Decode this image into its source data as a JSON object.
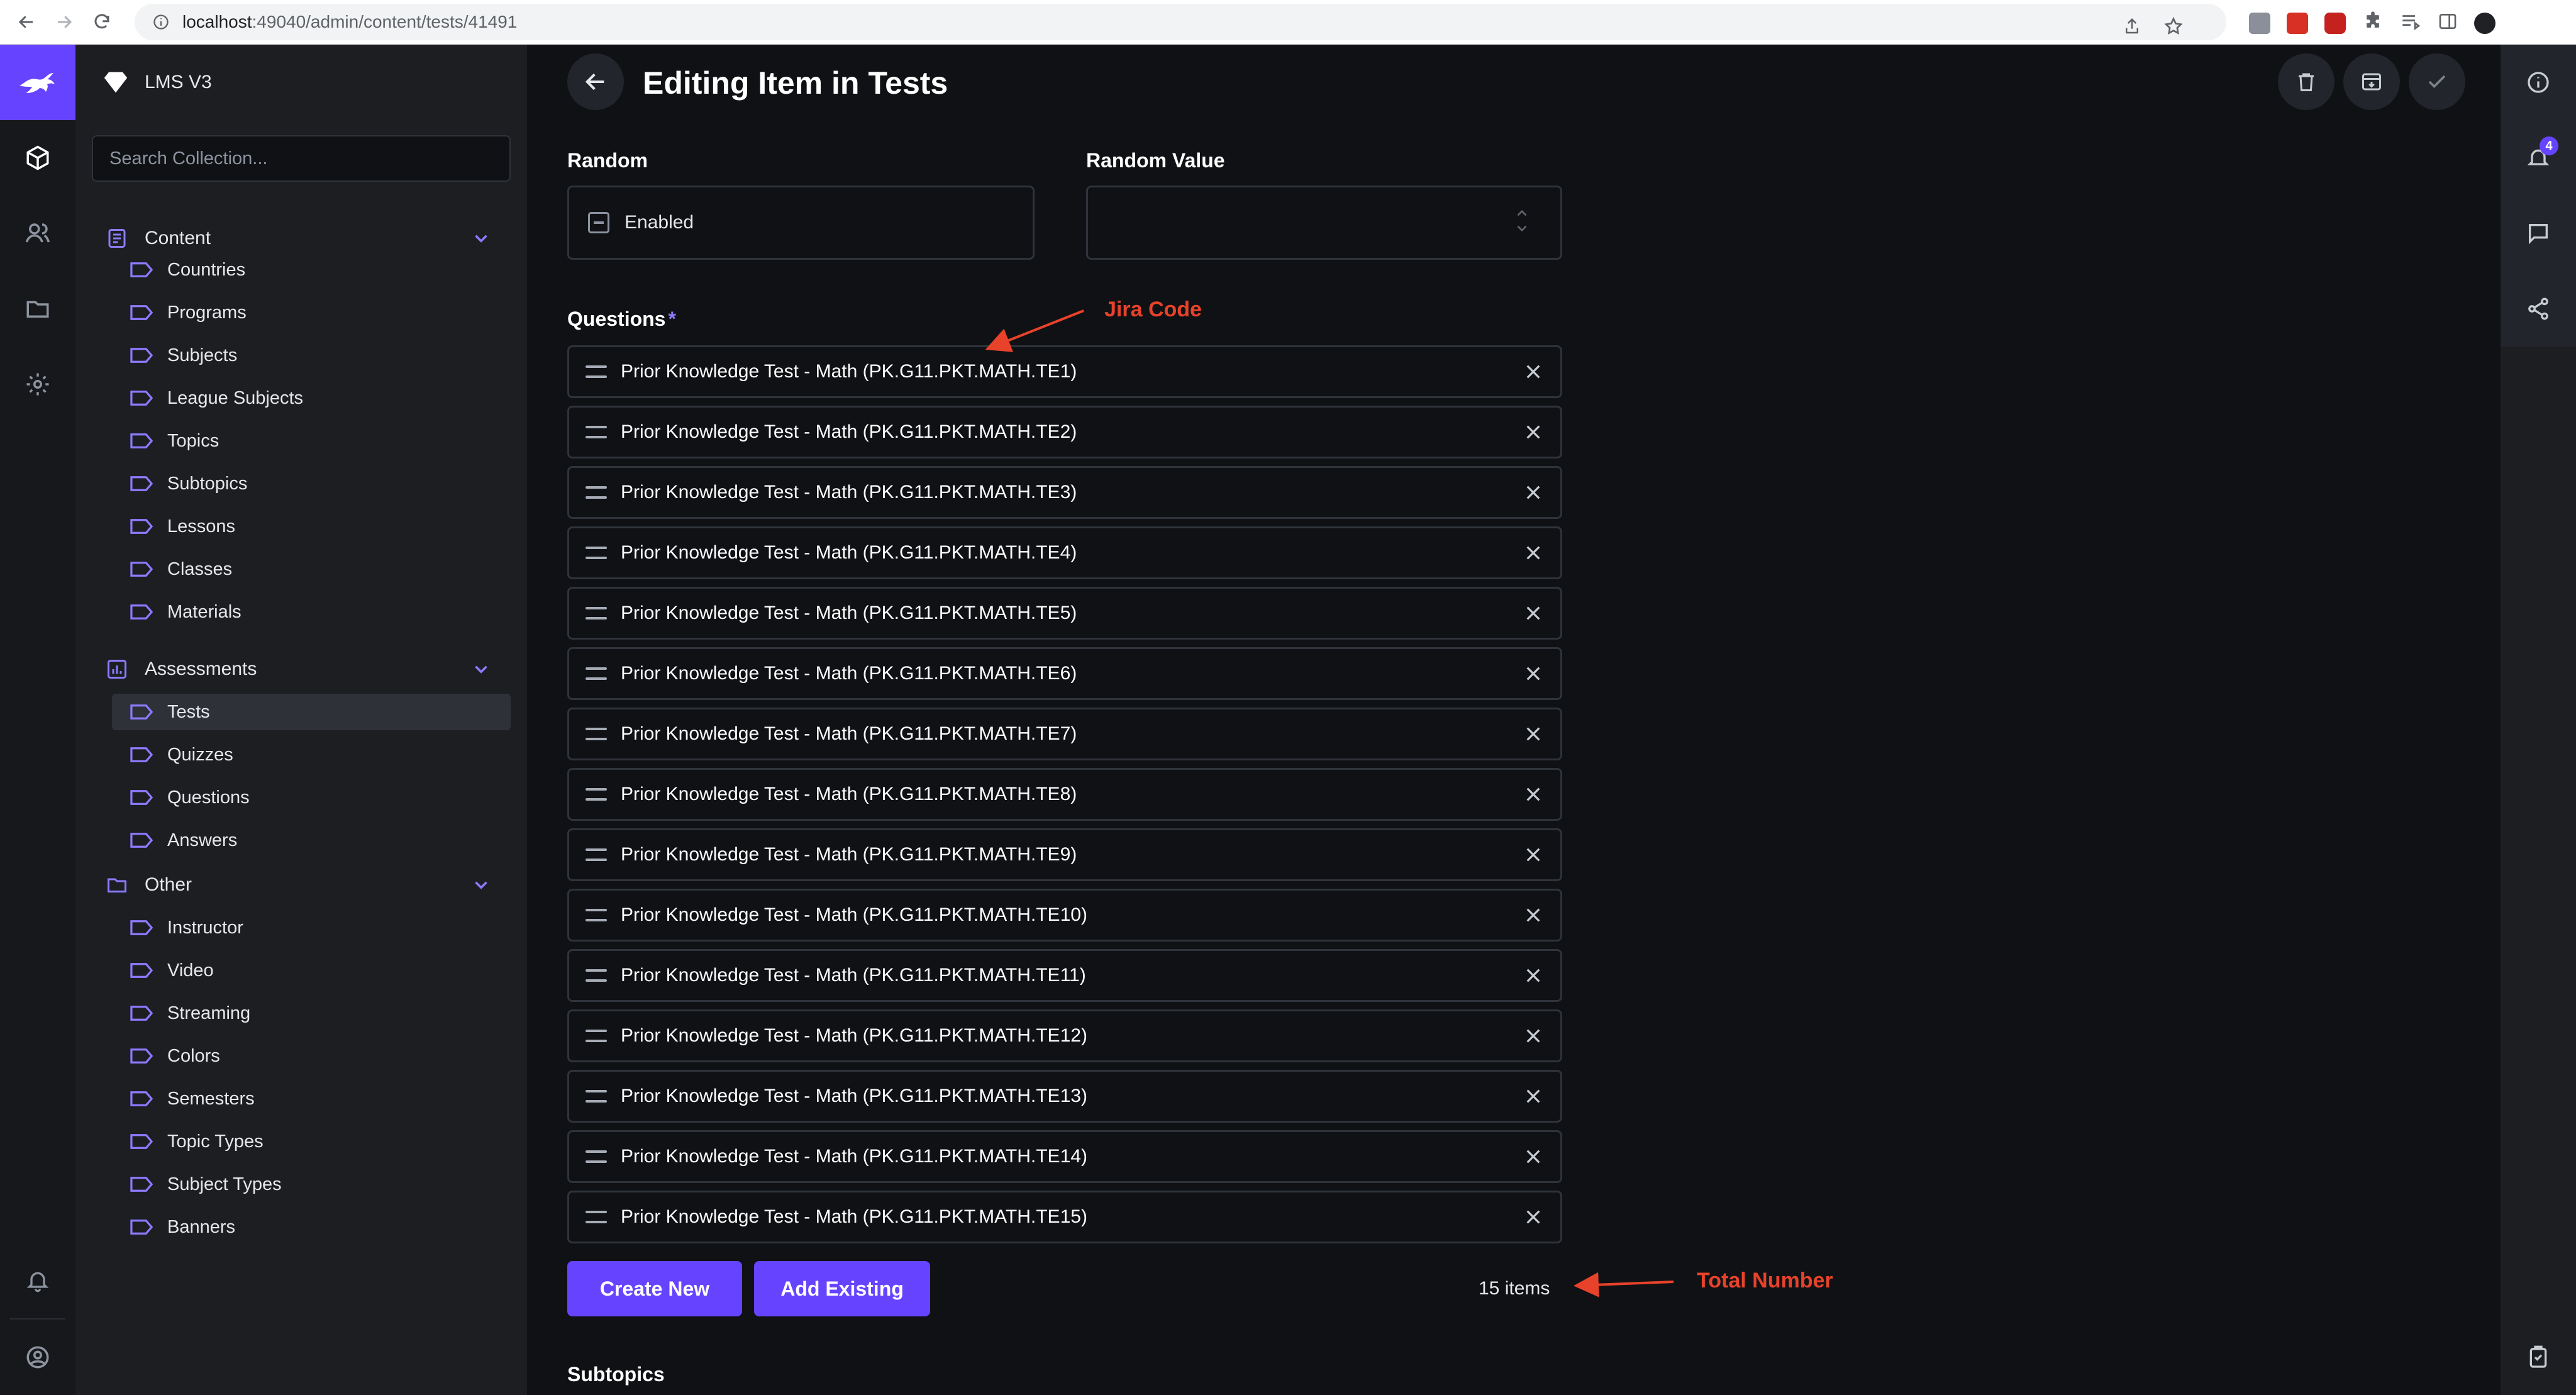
{
  "browser": {
    "url_host": "localhost",
    "url_path": ":49040/admin/content/tests/41491"
  },
  "sidebar": {
    "project_name": "LMS V3",
    "search_placeholder": "Search Collection...",
    "groups": [
      {
        "label": "Content",
        "icon": "document-icon",
        "items": [
          "Countries",
          "Programs",
          "Subjects",
          "League Subjects",
          "Topics",
          "Subtopics",
          "Lessons",
          "Classes",
          "Materials"
        ]
      },
      {
        "label": "Assessments",
        "icon": "chart-icon",
        "items": [
          "Tests",
          "Quizzes",
          "Questions",
          "Answers"
        ],
        "active": "Tests"
      },
      {
        "label": "Other",
        "icon": "folder-icon",
        "items": [
          "Instructor",
          "Video",
          "Streaming",
          "Colors",
          "Semesters",
          "Topic Types",
          "Subject Types",
          "Banners"
        ]
      }
    ]
  },
  "header": {
    "title": "Editing Item in Tests"
  },
  "form": {
    "random": {
      "label": "Random",
      "value": "Enabled"
    },
    "random_value": {
      "label": "Random Value",
      "value": ""
    },
    "questions": {
      "label": "Questions",
      "required_mark": "*",
      "items": [
        "Prior Knowledge Test - Math (PK.G11.PKT.MATH.TE1)",
        "Prior Knowledge Test - Math (PK.G11.PKT.MATH.TE2)",
        "Prior Knowledge Test - Math (PK.G11.PKT.MATH.TE3)",
        "Prior Knowledge Test - Math (PK.G11.PKT.MATH.TE4)",
        "Prior Knowledge Test - Math (PK.G11.PKT.MATH.TE5)",
        "Prior Knowledge Test - Math (PK.G11.PKT.MATH.TE6)",
        "Prior Knowledge Test - Math (PK.G11.PKT.MATH.TE7)",
        "Prior Knowledge Test - Math (PK.G11.PKT.MATH.TE8)",
        "Prior Knowledge Test - Math (PK.G11.PKT.MATH.TE9)",
        "Prior Knowledge Test - Math (PK.G11.PKT.MATH.TE10)",
        "Prior Knowledge Test - Math (PK.G11.PKT.MATH.TE11)",
        "Prior Knowledge Test - Math (PK.G11.PKT.MATH.TE12)",
        "Prior Knowledge Test - Math (PK.G11.PKT.MATH.TE13)",
        "Prior Knowledge Test - Math (PK.G11.PKT.MATH.TE14)",
        "Prior Knowledge Test - Math (PK.G11.PKT.MATH.TE15)"
      ],
      "create_new_label": "Create New",
      "add_existing_label": "Add Existing",
      "count_text": "15 items"
    },
    "subtopics": {
      "label": "Subtopics"
    }
  },
  "annotations": {
    "jira_code": "Jira Code",
    "total_number": "Total Number"
  },
  "right_rail": {
    "notification_badge": "4"
  },
  "colors": {
    "accent": "#6644ff",
    "annotation": "#e8422b",
    "background": "#0f1114",
    "sidebar": "#1c1e22"
  }
}
